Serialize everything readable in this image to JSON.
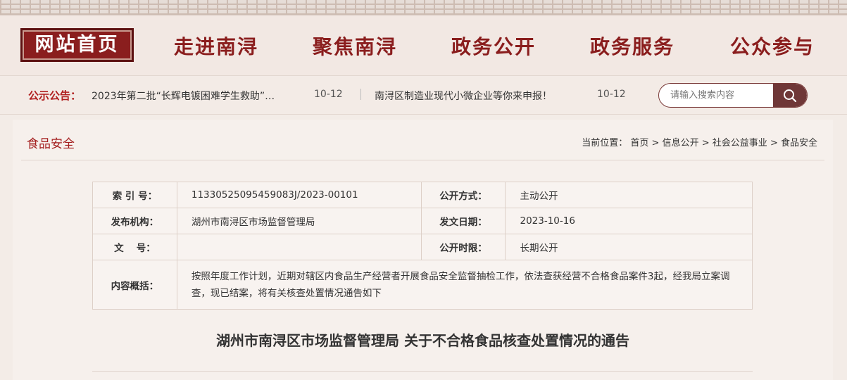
{
  "nav": {
    "home": "网站首页",
    "items": [
      "走进南浔",
      "聚焦南浔",
      "政务公开",
      "政务服务",
      "公众参与"
    ]
  },
  "notice": {
    "label": "公示公告：",
    "items": [
      {
        "title": "2023年第二批“长辉电镀困难学生救助”…",
        "date": "10-12"
      },
      {
        "title": "南浔区制造业现代小微企业等你来申报！",
        "date": "10-12"
      }
    ]
  },
  "search": {
    "placeholder": "请输入搜索内容",
    "icon": "search-icon"
  },
  "section": {
    "title": "食品安全"
  },
  "breadcrumb": {
    "label": "当前位置：",
    "items": [
      "首页",
      "信息公开",
      "社会公益事业",
      "食品安全"
    ],
    "sep": ">"
  },
  "meta": {
    "index_label": "索 引 号：",
    "index_value": "11330525095459083J/2023-00101",
    "open_mode_label": "公开方式：",
    "open_mode_value": "主动公开",
    "issuer_label": "发布机构：",
    "issuer_value": "湖州市南浔区市场监督管理局",
    "date_label": "发文日期：",
    "date_value": "2023-10-16",
    "doc_no_label": "文　 号：",
    "doc_no_value": "",
    "period_label": "公开时限：",
    "period_value": "长期公开",
    "summary_label": "内容概括：",
    "summary_value": "按照年度工作计划，近期对辖区内食品生产经营者开展食品安全监督抽检工作，依法查获经营不合格食品案件3起，经我局立案调查，现已结案，将有关核查处置情况通告如下"
  },
  "article": {
    "title": "湖州市南浔区市场监督管理局 关于不合格食品核查处置情况的通告"
  },
  "colors": {
    "brand": "#8a1d1d",
    "accent": "#b01f1f",
    "background": "#f3ece7"
  }
}
